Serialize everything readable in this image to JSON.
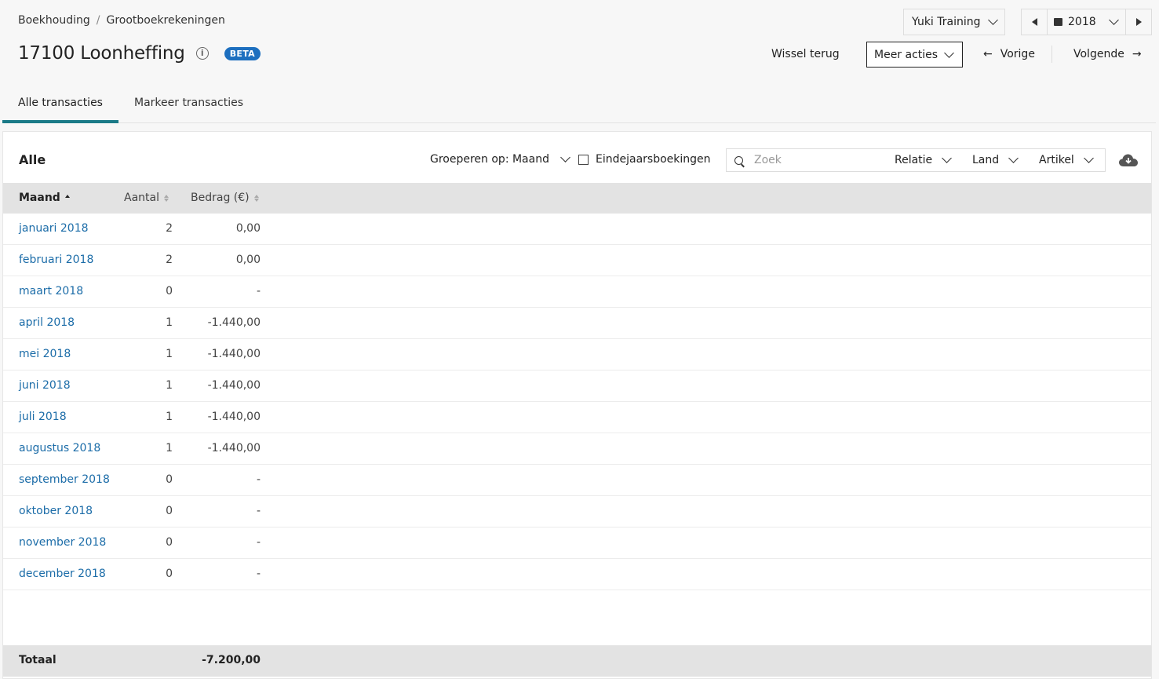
{
  "breadcrumb": {
    "root": "Boekhouding",
    "separator": "/",
    "current": "Grootboekrekeningen"
  },
  "header": {
    "title": "17100 Loonheffing",
    "info_icon": "i",
    "badge": "BETA"
  },
  "company_select": {
    "value": "Yuki Training"
  },
  "year_select": {
    "value": "2018"
  },
  "actions": {
    "wissel_terug": "Wissel terug",
    "meer_acties": "Meer acties",
    "vorige": "Vorige",
    "volgende": "Volgende",
    "arrow_left": "←",
    "arrow_right": "→"
  },
  "tabs": [
    {
      "label": "Alle transacties",
      "active": true
    },
    {
      "label": "Markeer transacties",
      "active": false
    }
  ],
  "panel": {
    "title": "Alle",
    "groeperen": "Groeperen op: Maand",
    "eindejaars": "Eindejaarsboekingen",
    "search_placeholder": "Zoek",
    "filters": {
      "relatie": "Relatie",
      "land": "Land",
      "artikel": "Artikel"
    }
  },
  "table": {
    "columns": {
      "maand": "Maand",
      "aantal": "Aantal",
      "bedrag": "Bedrag (€)"
    },
    "rows": [
      {
        "month": "januari 2018",
        "count": "2",
        "amount": "0,00"
      },
      {
        "month": "februari 2018",
        "count": "2",
        "amount": "0,00"
      },
      {
        "month": "maart 2018",
        "count": "0",
        "amount": "-"
      },
      {
        "month": "april 2018",
        "count": "1",
        "amount": "-1.440,00"
      },
      {
        "month": "mei 2018",
        "count": "1",
        "amount": "-1.440,00"
      },
      {
        "month": "juni 2018",
        "count": "1",
        "amount": "-1.440,00"
      },
      {
        "month": "juli 2018",
        "count": "1",
        "amount": "-1.440,00"
      },
      {
        "month": "augustus 2018",
        "count": "1",
        "amount": "-1.440,00"
      },
      {
        "month": "september 2018",
        "count": "0",
        "amount": "-"
      },
      {
        "month": "oktober 2018",
        "count": "0",
        "amount": "-"
      },
      {
        "month": "november 2018",
        "count": "0",
        "amount": "-"
      },
      {
        "month": "december 2018",
        "count": "0",
        "amount": "-"
      }
    ],
    "total_label": "Totaal",
    "total_amount": "-7.200,00"
  },
  "colors": {
    "link": "#1b6ca8",
    "accent_tab": "#1a7a87",
    "badge": "#1d6fbf",
    "header_bg": "#e3e3e3"
  }
}
